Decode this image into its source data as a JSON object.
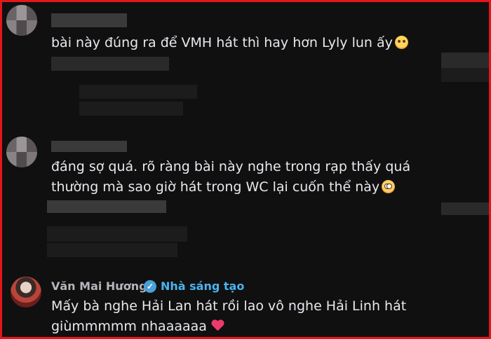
{
  "comments": [
    {
      "text": "bài này đúng ra để VMH hát thì hay hơn Lyly lun ấy",
      "emoji": "relieved-face"
    },
    {
      "line1": "đáng sợ quá. rõ ràng bài này nghe trong rạp thấy quá",
      "line2": "thường mà sao giờ hát trong WC lại cuốn thể này",
      "emoji": "flushed-face"
    }
  ],
  "featured_comment": {
    "username": "Văn Mai Hương",
    "badge": "Nhà sáng tạo",
    "line1": "Mấy bà nghe Hải Lan hát rồi lao vô nghe Hải Linh hát",
    "line2": "giùmmmmm nhaaaaaa",
    "emoji": "heart"
  },
  "colors": {
    "frame_border": "#e4161b",
    "background": "#101010",
    "badge": "#4bb3f0",
    "verified": "#4a9fd8",
    "heart": "#ec3b6a"
  }
}
